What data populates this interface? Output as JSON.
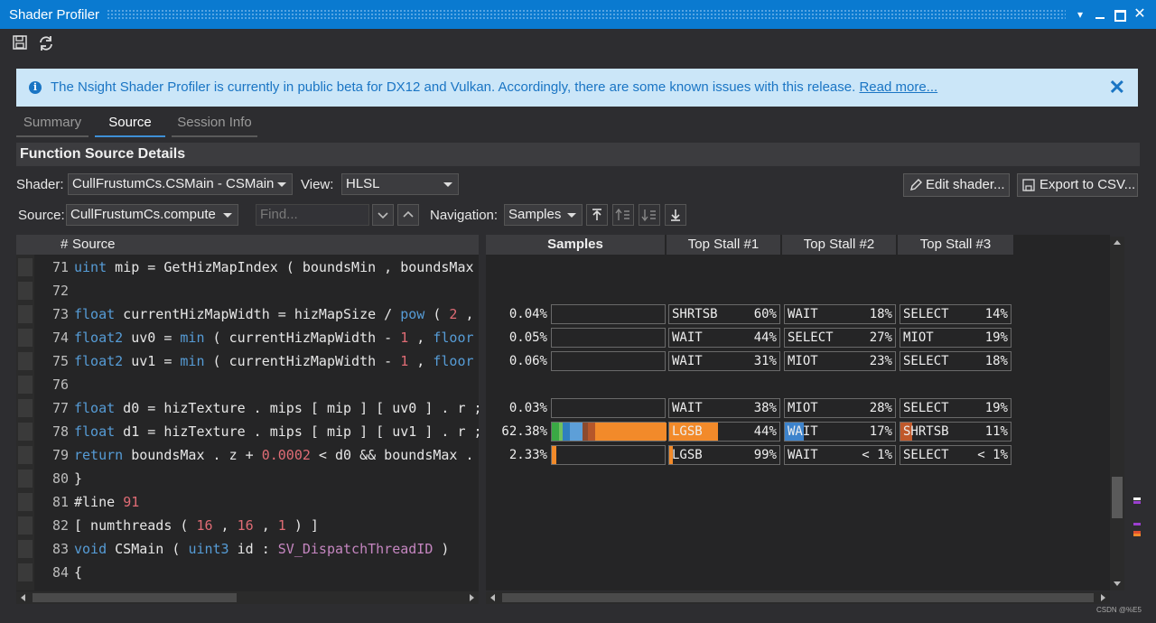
{
  "window": {
    "title": "Shader Profiler"
  },
  "toolbar": {
    "icons": [
      "save-icon",
      "refresh-icon"
    ]
  },
  "banner": {
    "message": "The Nsight Shader Profiler is currently in public beta for DX12 and Vulkan. Accordingly, there are some known issues with this release.",
    "link": "Read more...",
    "close": "✕"
  },
  "tabs": [
    {
      "label": "Summary"
    },
    {
      "label": "Source"
    },
    {
      "label": "Session Info"
    }
  ],
  "section": {
    "title": "Function Source Details"
  },
  "controls": {
    "shader_label": "Shader:",
    "shader_value": "CullFrustumCs.CSMain - CSMain",
    "view_label": "View:",
    "view_value": "HLSL",
    "edit_button": "Edit shader...",
    "export_button": "Export to CSV...",
    "source_label": "Source:",
    "source_value": "CullFrustumCs.compute",
    "find_placeholder": "Find...",
    "navigation_label": "Navigation:",
    "navigation_value": "Samples"
  },
  "source_header": {
    "num": "#",
    "label": "Source"
  },
  "metrics_header": {
    "samples": "Samples",
    "stall1": "Top Stall #1",
    "stall2": "Top Stall #2",
    "stall3": "Top Stall #3"
  },
  "lines": [
    {
      "n": "71",
      "tokens": [
        [
          "kw",
          "uint"
        ],
        [
          "tx",
          " mip = GetHizMapIndex ( boundsMin , boundsMax"
        ]
      ]
    },
    {
      "n": "72",
      "tokens": []
    },
    {
      "n": "73",
      "tokens": [
        [
          "kw",
          "float"
        ],
        [
          "tx",
          " currentHizMapWidth = hizMapSize / "
        ],
        [
          "kw",
          "pow"
        ],
        [
          "tx",
          " ( "
        ],
        [
          "num",
          "2"
        ],
        [
          "tx",
          " ,"
        ]
      ]
    },
    {
      "n": "74",
      "tokens": [
        [
          "kw",
          "float2"
        ],
        [
          "tx",
          " uv0 = "
        ],
        [
          "kw",
          "min"
        ],
        [
          "tx",
          " ( currentHizMapWidth - "
        ],
        [
          "num",
          "1"
        ],
        [
          "tx",
          " , "
        ],
        [
          "kw",
          "floor"
        ]
      ]
    },
    {
      "n": "75",
      "tokens": [
        [
          "kw",
          "float2"
        ],
        [
          "tx",
          " uv1 = "
        ],
        [
          "kw",
          "min"
        ],
        [
          "tx",
          " ( currentHizMapWidth - "
        ],
        [
          "num",
          "1"
        ],
        [
          "tx",
          " , "
        ],
        [
          "kw",
          "floor"
        ]
      ]
    },
    {
      "n": "76",
      "tokens": []
    },
    {
      "n": "77",
      "tokens": [
        [
          "kw",
          "float"
        ],
        [
          "tx",
          " d0 = hizTexture . mips [ mip ] [ uv0 ] . r ;"
        ]
      ]
    },
    {
      "n": "78",
      "tokens": [
        [
          "kw",
          "float"
        ],
        [
          "tx",
          " d1 = hizTexture . mips [ mip ] [ uv1 ] . r ;"
        ]
      ]
    },
    {
      "n": "79",
      "tokens": [
        [
          "kw",
          "return"
        ],
        [
          "tx",
          " boundsMax . z + "
        ],
        [
          "num",
          "0.0002"
        ],
        [
          "tx",
          " < d0 && boundsMax ."
        ]
      ]
    },
    {
      "n": "80",
      "tokens": [
        [
          "tx",
          "}"
        ]
      ]
    },
    {
      "n": "81",
      "tokens": [
        [
          "tx",
          "#line "
        ],
        [
          "num",
          "91"
        ]
      ]
    },
    {
      "n": "82",
      "tokens": [
        [
          "tx",
          "[ numthreads ( "
        ],
        [
          "num",
          "16"
        ],
        [
          "tx",
          " , "
        ],
        [
          "num",
          "16"
        ],
        [
          "tx",
          " , "
        ],
        [
          "num",
          "1"
        ],
        [
          "tx",
          " ) ]"
        ]
      ]
    },
    {
      "n": "83",
      "tokens": [
        [
          "kw",
          "void"
        ],
        [
          "tx",
          " CSMain ( "
        ],
        [
          "kw",
          "uint3"
        ],
        [
          "tx",
          " id : "
        ],
        [
          "pp",
          "SV_DispatchThreadID"
        ],
        [
          "tx",
          " )"
        ]
      ]
    },
    {
      "n": "84",
      "tokens": [
        [
          "tx",
          "{"
        ]
      ]
    }
  ],
  "metric_rows": [
    {
      "line": "73",
      "samples": "0.04%",
      "frac": 0.0004,
      "segs": [],
      "stalls": [
        [
          "SHRTSB",
          "60%"
        ],
        [
          "WAIT",
          "18%"
        ],
        [
          "SELECT",
          "14%"
        ]
      ],
      "fills": [
        null,
        null,
        null
      ]
    },
    {
      "line": "74",
      "samples": "0.05%",
      "frac": 0.0005,
      "segs": [],
      "stalls": [
        [
          "WAIT",
          "44%"
        ],
        [
          "SELECT",
          "27%"
        ],
        [
          "MIOT",
          "19%"
        ]
      ],
      "fills": [
        null,
        null,
        null
      ]
    },
    {
      "line": "75",
      "samples": "0.06%",
      "frac": 0.0006,
      "segs": [],
      "stalls": [
        [
          "WAIT",
          "31%"
        ],
        [
          "MIOT",
          "23%"
        ],
        [
          "SELECT",
          "18%"
        ]
      ],
      "fills": [
        null,
        null,
        null
      ]
    },
    {
      "line": "77",
      "samples": "0.03%",
      "frac": 0.0003,
      "segs": [],
      "stalls": [
        [
          "WAIT",
          "38%"
        ],
        [
          "MIOT",
          "28%"
        ],
        [
          "SELECT",
          "19%"
        ]
      ],
      "fills": [
        null,
        null,
        null
      ]
    },
    {
      "line": "78",
      "samples": "62.38%",
      "frac": 0.6238,
      "segs": [
        [
          "#3aa845",
          0.06
        ],
        [
          "#70c060",
          0.03
        ],
        [
          "#2f7fbf",
          0.06
        ],
        [
          "#5d9fd8",
          0.11
        ],
        [
          "#8c4a2e",
          0.05
        ],
        [
          "#b5562a",
          0.06
        ],
        [
          "#f28a2a",
          0.63
        ]
      ],
      "stalls": [
        [
          "LGSB",
          "44%"
        ],
        [
          "WAIT",
          "17%"
        ],
        [
          "SHRTSB",
          "11%"
        ]
      ],
      "fills": [
        [
          "#f28a2a",
          0.44
        ],
        [
          "#3d83cc",
          0.17
        ],
        [
          "#c0592b",
          0.11
        ]
      ]
    },
    {
      "line": "79",
      "samples": "2.33%",
      "frac": 0.0233,
      "segs": [
        [
          "#f28a2a",
          1.0
        ]
      ],
      "stalls": [
        [
          "LGSB",
          "99%"
        ],
        [
          "WAIT",
          "< 1%"
        ],
        [
          "SELECT",
          "< 1%"
        ]
      ],
      "fills": [
        [
          "#f28a2a",
          0.03
        ],
        null,
        null
      ]
    }
  ],
  "colors": {
    "accent": "#0a7ad0",
    "lgsb": "#f28a2a",
    "wait": "#3d83cc",
    "shrtsb": "#c0592b"
  },
  "watermark": "CSDN @%E5"
}
